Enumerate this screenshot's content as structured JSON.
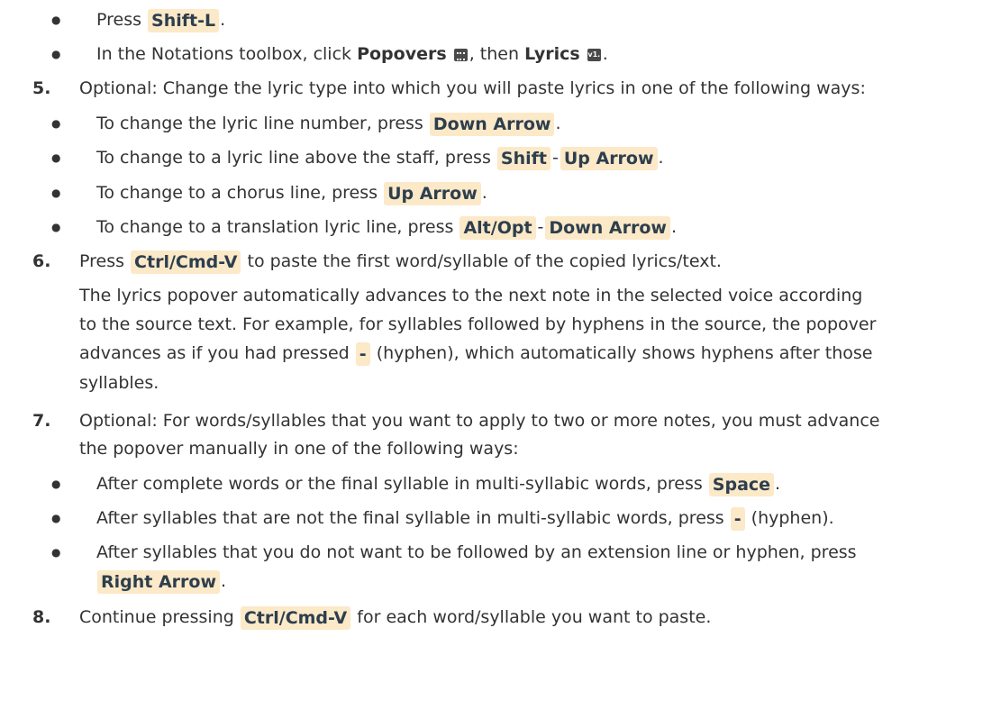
{
  "lines": [
    {
      "type": "bullet",
      "parts": [
        {
          "t": "Press "
        },
        {
          "k": "Shift-L"
        },
        {
          "t": "."
        }
      ]
    },
    {
      "type": "bullet",
      "parts": [
        {
          "t": "In the Notations toolbox, click "
        },
        {
          "b": "Popovers"
        },
        {
          "t": " "
        },
        {
          "icon": "keyboard-icon"
        },
        {
          "t": ", then "
        },
        {
          "b": "Lyrics"
        },
        {
          "t": " "
        },
        {
          "icon": "v1-icon",
          "label": "v1."
        },
        {
          "t": "."
        }
      ]
    },
    {
      "type": "step",
      "num": "5.",
      "parts": [
        {
          "t": "Optional: Change the lyric type into which you will paste lyrics in one of the following ways:"
        }
      ]
    },
    {
      "type": "bullet",
      "parts": [
        {
          "t": "To change the lyric line number, press "
        },
        {
          "k": "Down Arrow"
        },
        {
          "t": "."
        }
      ]
    },
    {
      "type": "bullet",
      "parts": [
        {
          "t": "To change to a lyric line above the staff, press "
        },
        {
          "k": "Shift"
        },
        {
          "sep": "-"
        },
        {
          "k": "Up Arrow"
        },
        {
          "t": "."
        }
      ]
    },
    {
      "type": "bullet",
      "parts": [
        {
          "t": "To change to a chorus line, press "
        },
        {
          "k": "Up Arrow"
        },
        {
          "t": "."
        }
      ]
    },
    {
      "type": "bullet",
      "parts": [
        {
          "t": "To change to a translation lyric line, press "
        },
        {
          "k": "Alt/Opt"
        },
        {
          "sep": "-"
        },
        {
          "k": "Down Arrow"
        },
        {
          "t": "."
        }
      ]
    },
    {
      "type": "step",
      "num": "6.",
      "parts": [
        {
          "t": "Press "
        },
        {
          "k": "Ctrl/Cmd-V"
        },
        {
          "t": " to paste the first word/syllable of the copied lyrics/text."
        }
      ]
    },
    {
      "type": "para",
      "parts": [
        {
          "t": "The lyrics popover automatically advances to the next note in the selected voice according"
        }
      ]
    },
    {
      "type": "para",
      "parts": [
        {
          "t": "to the source text. For example, for syllables followed by hyphens in the source, the popover"
        }
      ]
    },
    {
      "type": "para",
      "parts": [
        {
          "t": "advances as if you had pressed "
        },
        {
          "k": "-"
        },
        {
          "t": " (hyphen), which automatically shows hyphens after those"
        }
      ]
    },
    {
      "type": "para",
      "parts": [
        {
          "t": "syllables."
        }
      ]
    },
    {
      "type": "step",
      "num": "7.",
      "parts": [
        {
          "t": "Optional: For words/syllables that you want to apply to two or more notes, you must advance"
        }
      ]
    },
    {
      "type": "para",
      "parts": [
        {
          "t": "the popover manually in one of the following ways:"
        }
      ]
    },
    {
      "type": "bullet",
      "parts": [
        {
          "t": "After complete words or the final syllable in multi-syllabic words, press "
        },
        {
          "k": "Space"
        },
        {
          "t": "."
        }
      ]
    },
    {
      "type": "bullet",
      "parts": [
        {
          "t": "After syllables that are not the final syllable in multi-syllabic words, press "
        },
        {
          "k": "-"
        },
        {
          "t": " (hyphen)."
        }
      ]
    },
    {
      "type": "bullet",
      "parts": [
        {
          "t": "After syllables that you do not want to be followed by an extension line or hyphen, press"
        }
      ]
    },
    {
      "type": "bulletcont",
      "parts": [
        {
          "k": "Right Arrow"
        },
        {
          "t": "."
        }
      ]
    },
    {
      "type": "step",
      "num": "8.",
      "parts": [
        {
          "t": "Continue pressing "
        },
        {
          "k": "Ctrl/Cmd-V"
        },
        {
          "t": " for each word/syllable you want to paste."
        }
      ]
    }
  ]
}
